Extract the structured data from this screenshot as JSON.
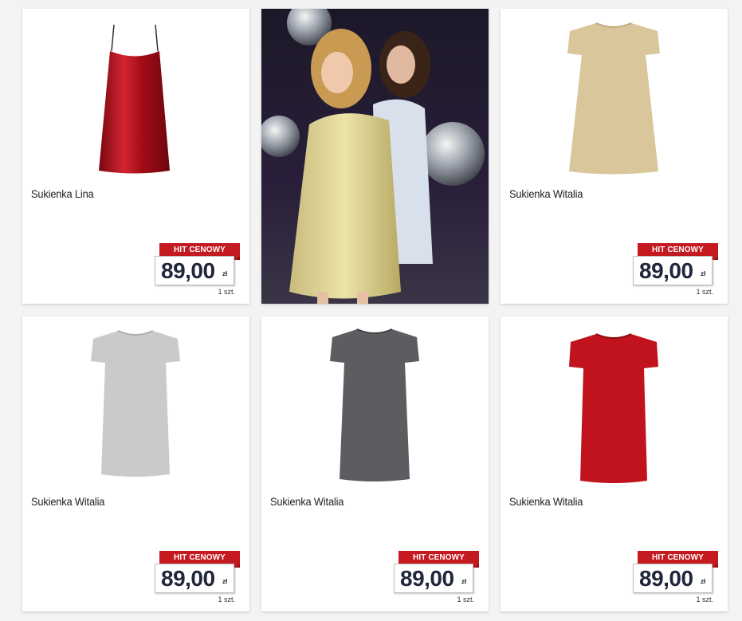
{
  "products": [
    {
      "name": "Sukienka Lina",
      "badge": "HIT CENOWY",
      "price": "89,00",
      "currency": "zł",
      "unit": "1 szt.",
      "color": "#b3121c",
      "style": "slip"
    },
    {
      "name": "Sukienka Witalia",
      "badge": "HIT CENOWY",
      "price": "89,00",
      "currency": "zł",
      "unit": "1 szt.",
      "color": "#d9c69a",
      "style": "tshirt"
    },
    {
      "name": "Sukienka Witalia",
      "badge": "HIT CENOWY",
      "price": "89,00",
      "currency": "zł",
      "unit": "1 szt.",
      "color": "#c9cacc",
      "style": "tshirt"
    },
    {
      "name": "Sukienka Witalia",
      "badge": "HIT CENOWY",
      "price": "89,00",
      "currency": "zł",
      "unit": "1 szt.",
      "color": "#5b5d60",
      "style": "tshirt"
    },
    {
      "name": "Sukienka Witalia",
      "badge": "HIT CENOWY",
      "price": "89,00",
      "currency": "zł",
      "unit": "1 szt.",
      "color": "#c0131d",
      "style": "tshirt"
    }
  ],
  "promo": {
    "icon": "promo-photo-two-models-disco-balls",
    "background": "#1a1424"
  }
}
